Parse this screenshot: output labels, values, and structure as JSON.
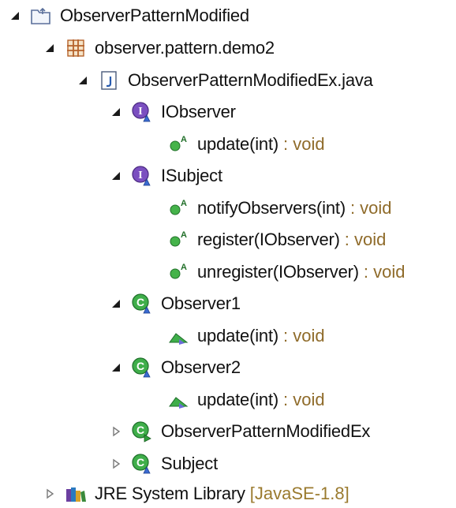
{
  "tree": {
    "project": {
      "label": "ObserverPatternModified",
      "icon": "java-project-icon",
      "expanded": true
    },
    "package": {
      "label": "observer.pattern.demo2",
      "icon": "package-icon",
      "expanded": true
    },
    "file": {
      "label": "ObserverPatternModifiedEx.java",
      "icon": "java-file-icon",
      "expanded": true
    },
    "iobserver": {
      "label": "IObserver",
      "icon": "interface-icon",
      "expanded": true,
      "methods": [
        {
          "name": "update(int)",
          "type": ": void",
          "icon": "abstract-method-icon"
        }
      ]
    },
    "isubject": {
      "label": "ISubject",
      "icon": "interface-icon",
      "expanded": true,
      "methods": [
        {
          "name": "notifyObservers(int)",
          "type": ": void",
          "icon": "abstract-method-icon"
        },
        {
          "name": "register(IObserver)",
          "type": ": void",
          "icon": "abstract-method-icon"
        },
        {
          "name": "unregister(IObserver)",
          "type": ": void",
          "icon": "abstract-method-icon"
        }
      ]
    },
    "observer1": {
      "label": "Observer1",
      "icon": "class-icon",
      "expanded": true,
      "methods": [
        {
          "name": "update(int)",
          "type": ": void",
          "icon": "default-method-icon"
        }
      ]
    },
    "observer2": {
      "label": "Observer2",
      "icon": "class-icon",
      "expanded": true,
      "methods": [
        {
          "name": "update(int)",
          "type": ": void",
          "icon": "default-method-icon"
        }
      ]
    },
    "mainclass": {
      "label": "ObserverPatternModifiedEx",
      "icon": "runnable-class-icon",
      "expanded": false
    },
    "subject": {
      "label": "Subject",
      "icon": "class-icon",
      "expanded": false
    },
    "jre": {
      "label": "JRE System Library",
      "decoration": "[JavaSE-1.8]",
      "icon": "library-icon",
      "expanded": false
    }
  },
  "colors": {
    "type_decoration": "#8f6b2a",
    "interface": "#6a3fa0",
    "class": "#2e8b3a",
    "package": "#b5622a",
    "method_green": "#3aa53a"
  }
}
